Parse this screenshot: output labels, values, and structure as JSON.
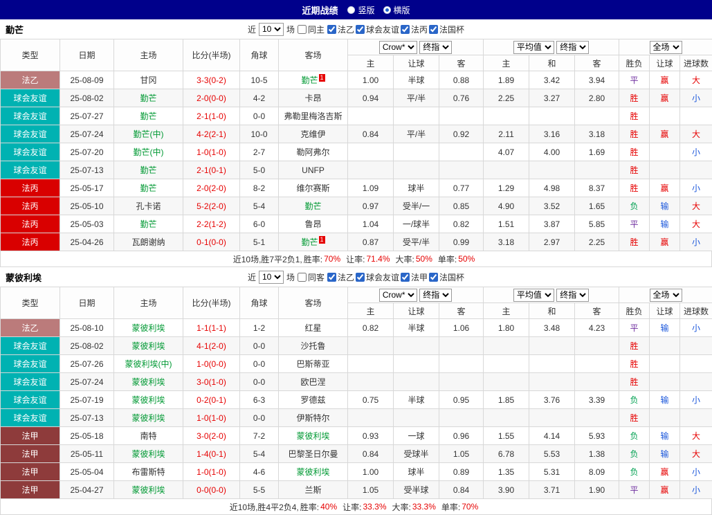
{
  "topbar": {
    "title": "近期战绩",
    "layout_options": [
      {
        "label": "竖版",
        "selected": false
      },
      {
        "label": "横版",
        "selected": true
      }
    ]
  },
  "type_colors": {
    "法乙": "#bb7b7b",
    "球会友谊": "#00b2b2",
    "法丙": "#d90000",
    "法甲": "#8e3b3b"
  },
  "table_header": {
    "cols": [
      "类型",
      "日期",
      "主场",
      "比分(半场)",
      "角球",
      "客场"
    ],
    "company": "Crow*",
    "stage": "终指",
    "average": "平均值",
    "stage2": "终指",
    "scope": "全场",
    "asian_cols": [
      "主",
      "让球",
      "客"
    ],
    "euro_cols": [
      "主",
      "和",
      "客"
    ],
    "result_cols": [
      "胜负",
      "让球",
      "进球数"
    ]
  },
  "sections": [
    {
      "team": "勤芒",
      "filters": {
        "near": "近",
        "count": "10",
        "unit": "场",
        "same": "同主",
        "same_checked": false,
        "leagues": [
          {
            "label": "法乙",
            "checked": true
          },
          {
            "label": "球会友谊",
            "checked": true
          },
          {
            "label": "法丙",
            "checked": true
          },
          {
            "label": "法国杯",
            "checked": true
          }
        ]
      },
      "rows": [
        {
          "type": "法乙",
          "date": "25-08-09",
          "home": "甘冈",
          "home_focus": false,
          "home_badge": "",
          "score": "3-3(0-2)",
          "corners": "10-5",
          "away": "勤芒",
          "away_focus": true,
          "away_badge": "1",
          "o1": "1.00",
          "o2": "半球",
          "o3": "0.88",
          "a1": "1.89",
          "a2": "3.42",
          "a3": "3.94",
          "result": "平",
          "hc": "赢",
          "goals": "大"
        },
        {
          "type": "球会友谊",
          "date": "25-08-02",
          "home": "勤芒",
          "home_focus": true,
          "home_badge": "",
          "score": "2-0(0-0)",
          "corners": "4-2",
          "away": "卡昂",
          "away_focus": false,
          "away_badge": "",
          "o1": "0.94",
          "o2": "平/半",
          "o3": "0.76",
          "a1": "2.25",
          "a2": "3.27",
          "a3": "2.80",
          "result": "胜",
          "hc": "赢",
          "goals": "小"
        },
        {
          "type": "球会友谊",
          "date": "25-07-27",
          "home": "勤芒",
          "home_focus": true,
          "home_badge": "",
          "score": "2-1(1-0)",
          "corners": "0-0",
          "away": "弗勒里梅洛吉斯",
          "away_focus": false,
          "away_badge": "",
          "o1": "",
          "o2": "",
          "o3": "",
          "a1": "",
          "a2": "",
          "a3": "",
          "result": "胜",
          "hc": "",
          "goals": ""
        },
        {
          "type": "球会友谊",
          "date": "25-07-24",
          "home": "勤芒(中)",
          "home_focus": true,
          "home_badge": "",
          "score": "4-2(2-1)",
          "corners": "10-0",
          "away": "克维伊",
          "away_focus": false,
          "away_badge": "",
          "o1": "0.84",
          "o2": "平/半",
          "o3": "0.92",
          "a1": "2.11",
          "a2": "3.16",
          "a3": "3.18",
          "result": "胜",
          "hc": "赢",
          "goals": "大"
        },
        {
          "type": "球会友谊",
          "date": "25-07-20",
          "home": "勤芒(中)",
          "home_focus": true,
          "home_badge": "",
          "score": "1-0(1-0)",
          "corners": "2-7",
          "away": "勒阿弗尔",
          "away_focus": false,
          "away_badge": "",
          "o1": "",
          "o2": "",
          "o3": "",
          "a1": "4.07",
          "a2": "4.00",
          "a3": "1.69",
          "result": "胜",
          "hc": "",
          "goals": "小"
        },
        {
          "type": "球会友谊",
          "date": "25-07-13",
          "home": "勤芒",
          "home_focus": true,
          "home_badge": "",
          "score": "2-1(0-1)",
          "corners": "5-0",
          "away": "UNFP",
          "away_focus": false,
          "away_badge": "",
          "o1": "",
          "o2": "",
          "o3": "",
          "a1": "",
          "a2": "",
          "a3": "",
          "result": "胜",
          "hc": "",
          "goals": ""
        },
        {
          "type": "法丙",
          "date": "25-05-17",
          "home": "勤芒",
          "home_focus": true,
          "home_badge": "",
          "score": "2-0(2-0)",
          "corners": "8-2",
          "away": "维尔赛斯",
          "away_focus": false,
          "away_badge": "",
          "o1": "1.09",
          "o2": "球半",
          "o3": "0.77",
          "a1": "1.29",
          "a2": "4.98",
          "a3": "8.37",
          "result": "胜",
          "hc": "赢",
          "goals": "小"
        },
        {
          "type": "法丙",
          "date": "25-05-10",
          "home": "孔卡诺",
          "home_focus": false,
          "home_badge": "",
          "score": "5-2(2-0)",
          "corners": "5-4",
          "away": "勤芒",
          "away_focus": true,
          "away_badge": "",
          "o1": "0.97",
          "o2": "受半/一",
          "o3": "0.85",
          "a1": "4.90",
          "a2": "3.52",
          "a3": "1.65",
          "result": "负",
          "hc": "输",
          "goals": "大"
        },
        {
          "type": "法丙",
          "date": "25-05-03",
          "home": "勤芒",
          "home_focus": true,
          "home_badge": "",
          "score": "2-2(1-2)",
          "corners": "6-0",
          "away": "鲁昂",
          "away_focus": false,
          "away_badge": "",
          "o1": "1.04",
          "o2": "一/球半",
          "o3": "0.82",
          "a1": "1.51",
          "a2": "3.87",
          "a3": "5.85",
          "result": "平",
          "hc": "输",
          "goals": "大"
        },
        {
          "type": "法丙",
          "date": "25-04-26",
          "home": "瓦朗谢纳",
          "home_focus": false,
          "home_badge": "",
          "score": "0-1(0-0)",
          "corners": "5-1",
          "away": "勤芒",
          "away_focus": true,
          "away_badge": "1",
          "o1": "0.87",
          "o2": "受平/半",
          "o3": "0.99",
          "a1": "3.18",
          "a2": "2.97",
          "a3": "2.25",
          "result": "胜",
          "hc": "赢",
          "goals": "小"
        }
      ],
      "summary": {
        "prefix": "近10场,胜7平2负1, ",
        "stats": [
          {
            "label": "胜率:",
            "value": "70%"
          },
          {
            "label": "让率:",
            "value": "71.4%"
          },
          {
            "label": "大率:",
            "value": "50%"
          },
          {
            "label": "单率:",
            "value": "50%"
          }
        ]
      }
    },
    {
      "team": "蒙彼利埃",
      "filters": {
        "near": "近",
        "count": "10",
        "unit": "场",
        "same": "同客",
        "same_checked": false,
        "leagues": [
          {
            "label": "法乙",
            "checked": true
          },
          {
            "label": "球会友谊",
            "checked": true
          },
          {
            "label": "法甲",
            "checked": true
          },
          {
            "label": "法国杯",
            "checked": true
          }
        ]
      },
      "rows": [
        {
          "type": "法乙",
          "date": "25-08-10",
          "home": "蒙彼利埃",
          "home_focus": true,
          "home_badge": "",
          "score": "1-1(1-1)",
          "corners": "1-2",
          "away": "红星",
          "away_focus": false,
          "away_badge": "",
          "o1": "0.82",
          "o2": "半球",
          "o3": "1.06",
          "a1": "1.80",
          "a2": "3.48",
          "a3": "4.23",
          "result": "平",
          "hc": "输",
          "goals": "小"
        },
        {
          "type": "球会友谊",
          "date": "25-08-02",
          "home": "蒙彼利埃",
          "home_focus": true,
          "home_badge": "",
          "score": "4-1(2-0)",
          "corners": "0-0",
          "away": "沙托鲁",
          "away_focus": false,
          "away_badge": "",
          "o1": "",
          "o2": "",
          "o3": "",
          "a1": "",
          "a2": "",
          "a3": "",
          "result": "胜",
          "hc": "",
          "goals": ""
        },
        {
          "type": "球会友谊",
          "date": "25-07-26",
          "home": "蒙彼利埃(中)",
          "home_focus": true,
          "home_badge": "",
          "score": "1-0(0-0)",
          "corners": "0-0",
          "away": "巴斯蒂亚",
          "away_focus": false,
          "away_badge": "",
          "o1": "",
          "o2": "",
          "o3": "",
          "a1": "",
          "a2": "",
          "a3": "",
          "result": "胜",
          "hc": "",
          "goals": ""
        },
        {
          "type": "球会友谊",
          "date": "25-07-24",
          "home": "蒙彼利埃",
          "home_focus": true,
          "home_badge": "",
          "score": "3-0(1-0)",
          "corners": "0-0",
          "away": "欧巴涅",
          "away_focus": false,
          "away_badge": "",
          "o1": "",
          "o2": "",
          "o3": "",
          "a1": "",
          "a2": "",
          "a3": "",
          "result": "胜",
          "hc": "",
          "goals": ""
        },
        {
          "type": "球会友谊",
          "date": "25-07-19",
          "home": "蒙彼利埃",
          "home_focus": true,
          "home_badge": "",
          "score": "0-2(0-1)",
          "corners": "6-3",
          "away": "罗德兹",
          "away_focus": false,
          "away_badge": "",
          "o1": "0.75",
          "o2": "半球",
          "o3": "0.95",
          "a1": "1.85",
          "a2": "3.76",
          "a3": "3.39",
          "result": "负",
          "hc": "输",
          "goals": "小"
        },
        {
          "type": "球会友谊",
          "date": "25-07-13",
          "home": "蒙彼利埃",
          "home_focus": true,
          "home_badge": "",
          "score": "1-0(1-0)",
          "corners": "0-0",
          "away": "伊斯特尔",
          "away_focus": false,
          "away_badge": "",
          "o1": "",
          "o2": "",
          "o3": "",
          "a1": "",
          "a2": "",
          "a3": "",
          "result": "胜",
          "hc": "",
          "goals": ""
        },
        {
          "type": "法甲",
          "date": "25-05-18",
          "home": "南特",
          "home_focus": false,
          "home_badge": "",
          "score": "3-0(2-0)",
          "corners": "7-2",
          "away": "蒙彼利埃",
          "away_focus": true,
          "away_badge": "",
          "o1": "0.93",
          "o2": "一球",
          "o3": "0.96",
          "a1": "1.55",
          "a2": "4.14",
          "a3": "5.93",
          "result": "负",
          "hc": "输",
          "goals": "大"
        },
        {
          "type": "法甲",
          "date": "25-05-11",
          "home": "蒙彼利埃",
          "home_focus": true,
          "home_badge": "",
          "score": "1-4(0-1)",
          "corners": "5-4",
          "away": "巴黎圣日尔曼",
          "away_focus": false,
          "away_badge": "",
          "o1": "0.84",
          "o2": "受球半",
          "o3": "1.05",
          "a1": "6.78",
          "a2": "5.53",
          "a3": "1.38",
          "result": "负",
          "hc": "输",
          "goals": "大"
        },
        {
          "type": "法甲",
          "date": "25-05-04",
          "home": "布雷斯特",
          "home_focus": false,
          "home_badge": "",
          "score": "1-0(1-0)",
          "corners": "4-6",
          "away": "蒙彼利埃",
          "away_focus": true,
          "away_badge": "",
          "o1": "1.00",
          "o2": "球半",
          "o3": "0.89",
          "a1": "1.35",
          "a2": "5.31",
          "a3": "8.09",
          "result": "负",
          "hc": "赢",
          "goals": "小"
        },
        {
          "type": "法甲",
          "date": "25-04-27",
          "home": "蒙彼利埃",
          "home_focus": true,
          "home_badge": "",
          "score": "0-0(0-0)",
          "corners": "5-5",
          "away": "兰斯",
          "away_focus": false,
          "away_badge": "",
          "o1": "1.05",
          "o2": "受半球",
          "o3": "0.84",
          "a1": "3.90",
          "a2": "3.71",
          "a3": "1.90",
          "result": "平",
          "hc": "赢",
          "goals": "小"
        }
      ],
      "summary": {
        "prefix": "近10场,胜4平2负4, ",
        "stats": [
          {
            "label": "胜率:",
            "value": "40%"
          },
          {
            "label": "让率:",
            "value": "33.3%"
          },
          {
            "label": "大率:",
            "value": "33.3%"
          },
          {
            "label": "单率:",
            "value": "70%"
          }
        ]
      }
    }
  ]
}
